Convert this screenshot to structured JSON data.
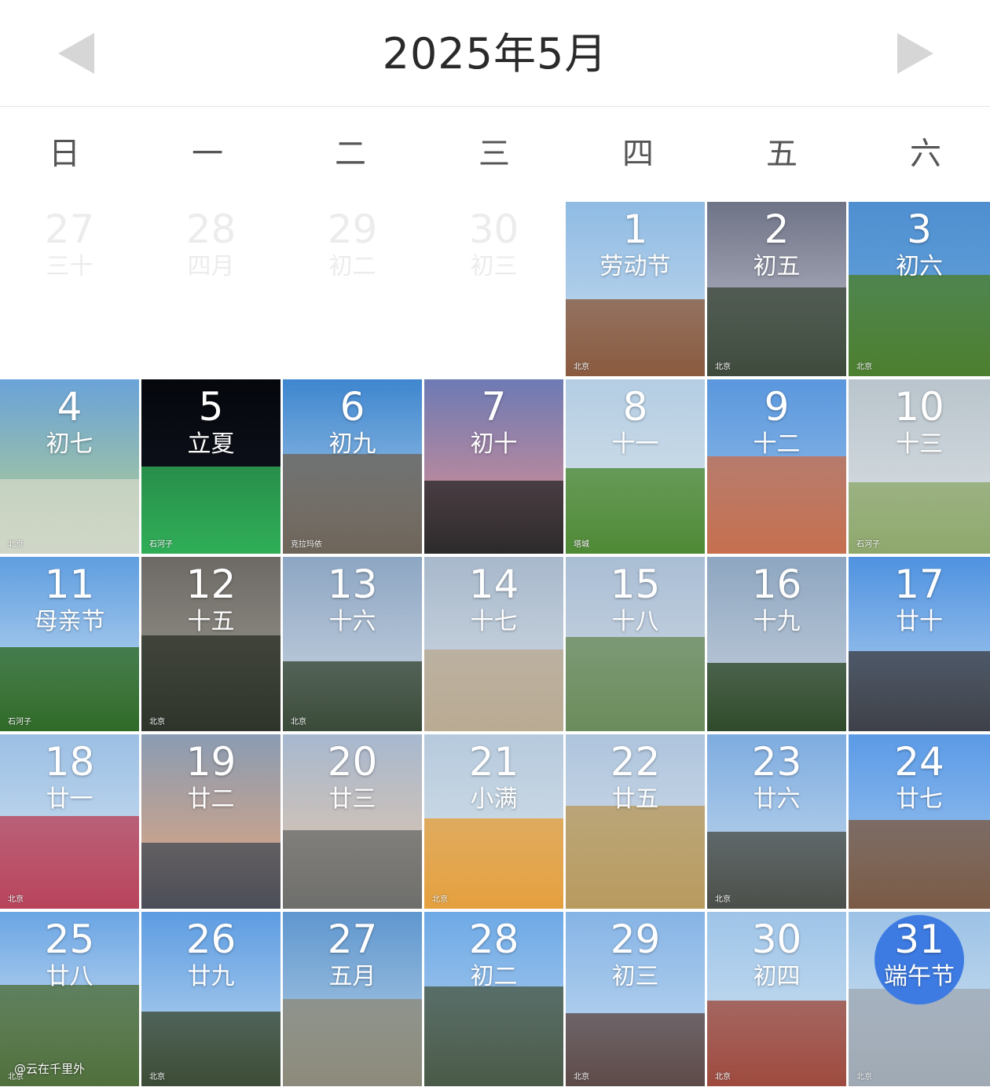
{
  "header": {
    "title": "2025年5月",
    "prev_icon": "left-triangle-icon",
    "next_icon": "right-triangle-icon"
  },
  "weekdays": [
    "日",
    "一",
    "二",
    "三",
    "四",
    "五",
    "六"
  ],
  "accent_color": "#3d7be3",
  "cells": [
    {
      "day": "27",
      "lunar": "三十",
      "adjacent": true
    },
    {
      "day": "28",
      "lunar": "四月",
      "adjacent": true
    },
    {
      "day": "29",
      "lunar": "初二",
      "adjacent": true
    },
    {
      "day": "30",
      "lunar": "初三",
      "adjacent": true
    },
    {
      "day": "1",
      "lunar": "劳动节",
      "sky": [
        "#8fbbe3",
        "#c9ddef"
      ],
      "ground": "#8a5a3e",
      "loc": "北京"
    },
    {
      "day": "2",
      "lunar": "初五",
      "sky": [
        "#6e7386",
        "#c7c8d4"
      ],
      "ground": "#3e4a3c",
      "loc": "北京"
    },
    {
      "day": "3",
      "lunar": "初六",
      "sky": [
        "#4f8fd0",
        "#6aa8de"
      ],
      "ground": "#4c7f2e",
      "loc": "北京"
    },
    {
      "day": "4",
      "lunar": "初七",
      "sky": [
        "#6aa3d9",
        "#b9d28a"
      ],
      "ground": "#cfd6c8",
      "loc": "北京"
    },
    {
      "day": "5",
      "lunar": "立夏",
      "sky": [
        "#05070d",
        "#131722"
      ],
      "ground": "#2fae57",
      "loc": "石河子"
    },
    {
      "day": "6",
      "lunar": "初九",
      "sky": [
        "#3e86cf",
        "#b7d3ea"
      ],
      "ground": "#6e655a",
      "loc": "克拉玛依"
    },
    {
      "day": "7",
      "lunar": "初十",
      "sky": [
        "#6d7ab4",
        "#e79290"
      ],
      "ground": "#2c2a2c",
      "loc": ""
    },
    {
      "day": "8",
      "lunar": "十一",
      "sky": [
        "#b4cde3",
        "#d9e4ea"
      ],
      "ground": "#4e8a35",
      "loc": "塔城"
    },
    {
      "day": "9",
      "lunar": "十二",
      "sky": [
        "#5a97dd",
        "#9cc3ea"
      ],
      "ground": "#c56f4f",
      "loc": ""
    },
    {
      "day": "10",
      "lunar": "十三",
      "sky": [
        "#b9c4cc",
        "#dde3e6"
      ],
      "ground": "#8ea86c",
      "loc": "石河子"
    },
    {
      "day": "11",
      "lunar": "母亲节",
      "sky": [
        "#5f9ee0",
        "#d2e4f3"
      ],
      "ground": "#2f6a27",
      "loc": "石河子"
    },
    {
      "day": "12",
      "lunar": "十五",
      "sky": [
        "#6d6a66",
        "#a29d94"
      ],
      "ground": "#2e342a",
      "loc": "北京"
    },
    {
      "day": "13",
      "lunar": "十六",
      "sky": [
        "#8da6c3",
        "#cfd8e3"
      ],
      "ground": "#3a4a38",
      "loc": "北京"
    },
    {
      "day": "14",
      "lunar": "十七",
      "sky": [
        "#a8b9cc",
        "#d5dde5"
      ],
      "ground": "#b9aa92",
      "loc": ""
    },
    {
      "day": "15",
      "lunar": "十八",
      "sky": [
        "#a9bdd4",
        "#d3dde6"
      ],
      "ground": "#6b8c5b",
      "loc": ""
    },
    {
      "day": "16",
      "lunar": "十九",
      "sky": [
        "#8ea6c1",
        "#c9d3dd"
      ],
      "ground": "#2f4a2a",
      "loc": ""
    },
    {
      "day": "17",
      "lunar": "廿十",
      "sky": [
        "#4f92e0",
        "#bad6f1"
      ],
      "ground": "#3d4048",
      "loc": ""
    },
    {
      "day": "18",
      "lunar": "廿一",
      "sky": [
        "#9bbfe4",
        "#d7e6f2"
      ],
      "ground": "#b8435b",
      "loc": "北京"
    },
    {
      "day": "19",
      "lunar": "廿二",
      "sky": [
        "#8a9cb3",
        "#e8a679"
      ],
      "ground": "#4a4e58",
      "loc": ""
    },
    {
      "day": "20",
      "lunar": "廿三",
      "sky": [
        "#a7b8cf",
        "#e9c8a8"
      ],
      "ground": "#6d6e6c",
      "loc": ""
    },
    {
      "day": "21",
      "lunar": "小满",
      "sky": [
        "#b6cadd",
        "#d9e3ea"
      ],
      "ground": "#e5a03e",
      "loc": "北京"
    },
    {
      "day": "22",
      "lunar": "廿五",
      "sky": [
        "#aec4dd",
        "#d8e2ea"
      ],
      "ground": "#b89a5e",
      "loc": ""
    },
    {
      "day": "23",
      "lunar": "廿六",
      "sky": [
        "#7eace0",
        "#c9ddef"
      ],
      "ground": "#4b4f4a",
      "loc": "北京"
    },
    {
      "day": "24",
      "lunar": "廿七",
      "sky": [
        "#5b9ae6",
        "#a9ccf0"
      ],
      "ground": "#7a5a45",
      "loc": ""
    },
    {
      "day": "25",
      "lunar": "廿八",
      "sky": [
        "#6aa5e4",
        "#e4edf5"
      ],
      "ground": "#4f6f3c",
      "loc": "北京"
    },
    {
      "day": "26",
      "lunar": "廿九",
      "sky": [
        "#5d9ce2",
        "#c4dcf0"
      ],
      "ground": "#3b4b35",
      "loc": "北京"
    },
    {
      "day": "27",
      "lunar": "五月",
      "sky": [
        "#5f97cf",
        "#bdd3e6"
      ],
      "ground": "#8c8a7a",
      "loc": ""
    },
    {
      "day": "28",
      "lunar": "初二",
      "sky": [
        "#6ea9e6",
        "#b7d4ef"
      ],
      "ground": "#4a5a48",
      "loc": ""
    },
    {
      "day": "29",
      "lunar": "初三",
      "sky": [
        "#86b4e6",
        "#c6dcf0"
      ],
      "ground": "#5d4a48",
      "loc": "北京"
    },
    {
      "day": "30",
      "lunar": "初四",
      "sky": [
        "#9ec4e8",
        "#d2e4f2"
      ],
      "ground": "#9e4a3e",
      "loc": "北京"
    },
    {
      "day": "31",
      "lunar": "端午节",
      "sky": [
        "#9cc2e6",
        "#d7e6f2"
      ],
      "ground": "#9fa9b4",
      "loc": "北京",
      "today": true
    }
  ],
  "watermark": "@云在千里外"
}
